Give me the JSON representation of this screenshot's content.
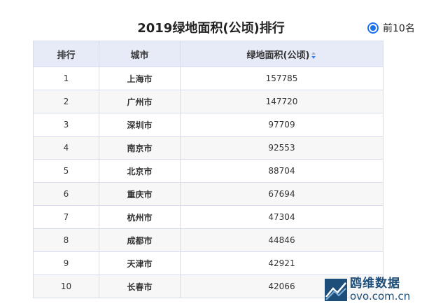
{
  "title": "2019绿地面积(公顷)排行",
  "filter": {
    "label": "前10名",
    "selected": true
  },
  "table": {
    "headers": [
      "排行",
      "城市",
      "绿地面积(公顷)"
    ],
    "rows": [
      {
        "rank": "1",
        "city": "上海市",
        "value": "157785"
      },
      {
        "rank": "2",
        "city": "广州市",
        "value": "147720"
      },
      {
        "rank": "3",
        "city": "深圳市",
        "value": "97709"
      },
      {
        "rank": "4",
        "city": "南京市",
        "value": "92553"
      },
      {
        "rank": "5",
        "city": "北京市",
        "value": "88704"
      },
      {
        "rank": "6",
        "city": "重庆市",
        "value": "67694"
      },
      {
        "rank": "7",
        "city": "杭州市",
        "value": "47304"
      },
      {
        "rank": "8",
        "city": "成都市",
        "value": "44846"
      },
      {
        "rank": "9",
        "city": "天津市",
        "value": "42921"
      },
      {
        "rank": "10",
        "city": "长春市",
        "value": "42066"
      }
    ]
  },
  "watermark": {
    "name": "鸥维数据",
    "url": "ovo.com.cn"
  },
  "colors": {
    "accent": "#1a73e8",
    "rank": "#e23a2f",
    "city": "#5b7bd5",
    "header_bg": "#e7ebf8",
    "brand": "#1d4e7a"
  },
  "icons": {
    "sort": "sort-icon",
    "logo": "ovo-logo-icon",
    "radio": "radio-selected-icon"
  }
}
